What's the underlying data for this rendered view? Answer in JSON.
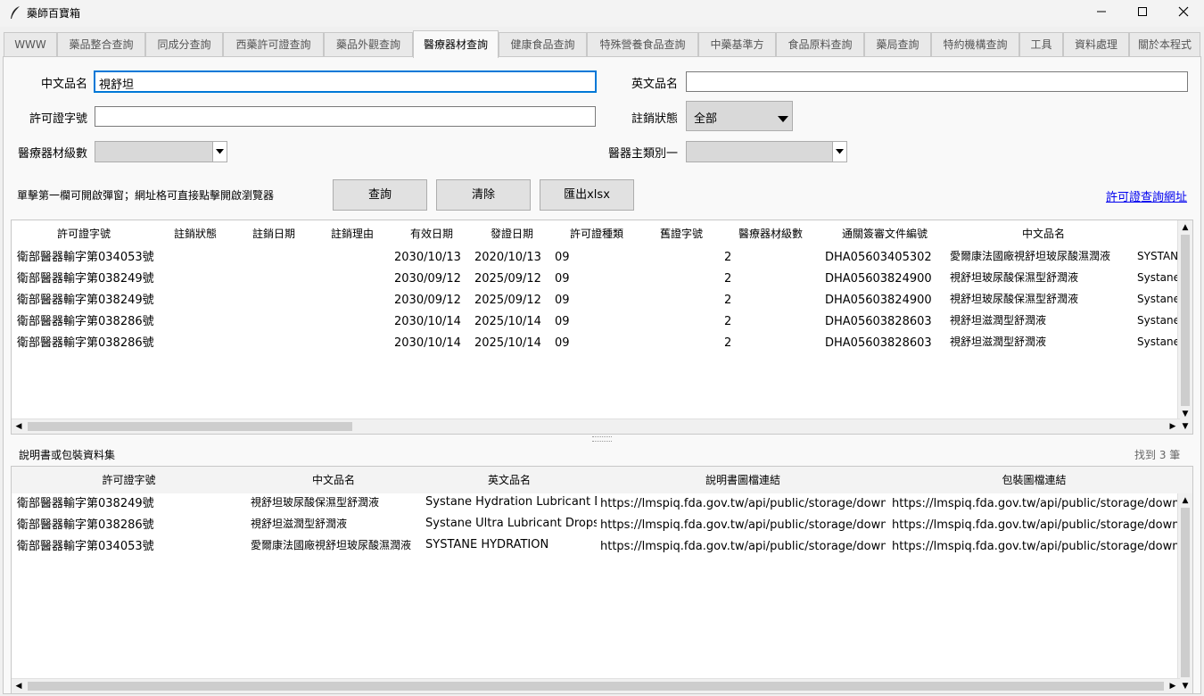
{
  "window": {
    "title": "藥師百寶箱"
  },
  "tabs": [
    "WWW",
    "藥品整合查詢",
    "同成分查詢",
    "西藥許可證查詢",
    "藥品外觀查詢",
    "醫療器材查詢",
    "健康食品查詢",
    "特殊營養食品查詢",
    "中藥基準方",
    "食品原料查詢",
    "藥局查詢",
    "特約機構查詢",
    "工具",
    "資料處理",
    "關於本程式"
  ],
  "form": {
    "cn_name_label": "中文品名",
    "cn_name_value": "視舒坦",
    "en_name_label": "英文品名",
    "en_name_value": "",
    "license_label": "許可證字號",
    "license_value": "",
    "status_label": "註銷狀態",
    "status_value": "全部",
    "class_label": "醫療器材級數",
    "class_value": "",
    "category_label": "醫器主類別一",
    "category_value": ""
  },
  "actions": {
    "hint": "單擊第一欄可開啟彈窗；網址格可直接點擊開啟瀏覽器",
    "query": "查詢",
    "clear": "清除",
    "export": "匯出xlsx",
    "license_link": "許可證查詢網址"
  },
  "results": {
    "headers": [
      "許可證字號",
      "註銷狀態",
      "註銷日期",
      "註銷理由",
      "有效日期",
      "發證日期",
      "許可證種類",
      "舊證字號",
      "醫療器材級數",
      "通關簽審文件編號",
      "中文品名",
      ""
    ],
    "rows": [
      [
        "衛部醫器輸字第034053號",
        "",
        "",
        "",
        "2030/10/13",
        "2020/10/13",
        "09",
        "",
        "2",
        "DHA05603405302",
        "愛爾康法國廠視舒坦玻尿酸濕潤液",
        "SYSTAN"
      ],
      [
        "衛部醫器輸字第038249號",
        "",
        "",
        "",
        "2030/09/12",
        "2025/09/12",
        "09",
        "",
        "2",
        "DHA05603824900",
        "視舒坦玻尿酸保濕型舒潤液",
        "Systane"
      ],
      [
        "衛部醫器輸字第038249號",
        "",
        "",
        "",
        "2030/09/12",
        "2025/09/12",
        "09",
        "",
        "2",
        "DHA05603824900",
        "視舒坦玻尿酸保濕型舒潤液",
        "Systane"
      ],
      [
        "衛部醫器輸字第038286號",
        "",
        "",
        "",
        "2030/10/14",
        "2025/10/14",
        "09",
        "",
        "2",
        "DHA05603828603",
        "視舒坦滋潤型舒潤液",
        "Systane"
      ],
      [
        "衛部醫器輸字第038286號",
        "",
        "",
        "",
        "2030/10/14",
        "2025/10/14",
        "09",
        "",
        "2",
        "DHA05603828603",
        "視舒坦滋潤型舒潤液",
        "Systane"
      ]
    ]
  },
  "docs": {
    "title": "說明書或包裝資料集",
    "count": "找到 3 筆",
    "headers": [
      "許可證字號",
      "中文品名",
      "英文品名",
      "說明書圖檔連結",
      "包裝圖檔連結"
    ],
    "rows": [
      [
        "衛部醫器輸字第038249號",
        "視舒坦玻尿酸保濕型舒潤液",
        "Systane Hydration Lubricant Dr",
        "https://lmspiq.fda.gov.tw/api/public/storage/downloa",
        "https://lmspiq.fda.gov.tw/api/public/storage/downloa"
      ],
      [
        "衛部醫器輸字第038286號",
        "視舒坦滋潤型舒潤液",
        "Systane Ultra Lubricant Drops",
        "https://lmspiq.fda.gov.tw/api/public/storage/downloa",
        "https://lmspiq.fda.gov.tw/api/public/storage/downloa"
      ],
      [
        "衛部醫器輸字第034053號",
        "愛爾康法國廠視舒坦玻尿酸濕潤液",
        "SYSTANE HYDRATION",
        "https://lmspiq.fda.gov.tw/api/public/storage/downloa",
        "https://lmspiq.fda.gov.tw/api/public/storage/downloa"
      ]
    ]
  },
  "icons": {
    "app": "feather-icon",
    "minimize": "minimize-icon",
    "maximize": "maximize-icon",
    "close": "close-icon"
  }
}
